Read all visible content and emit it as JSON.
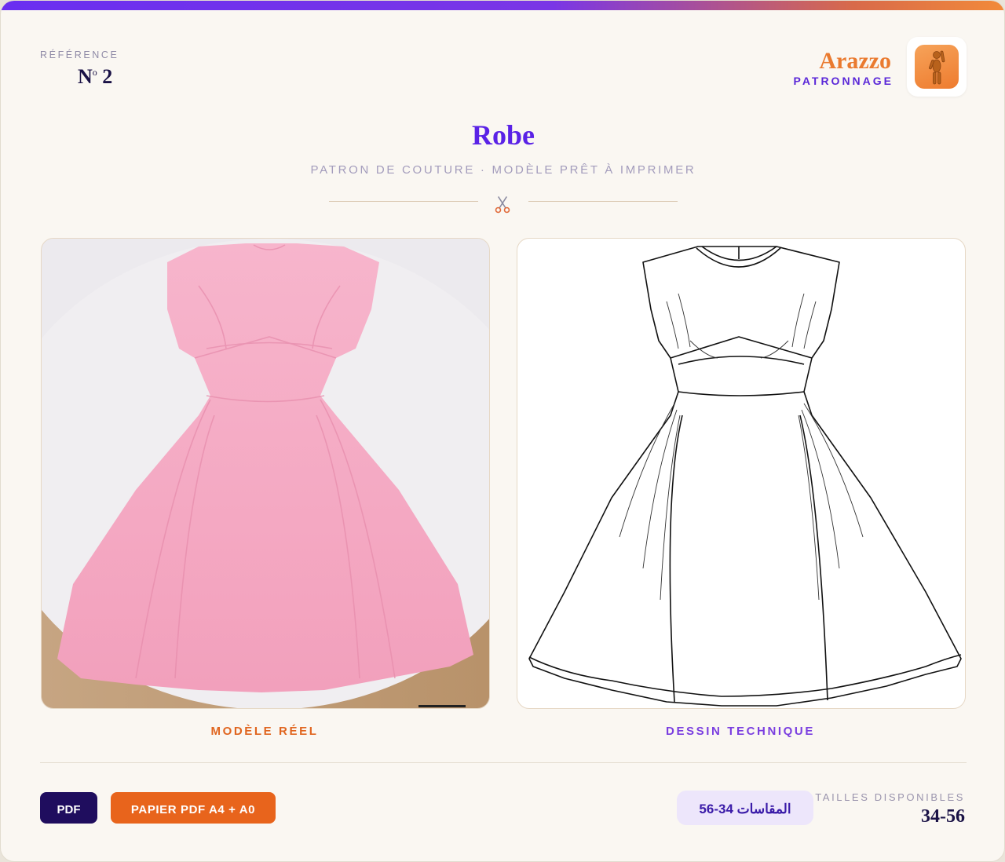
{
  "header": {
    "reference_label": "RÉFÉRENCE",
    "reference_prefix": "N",
    "reference_sup": "o",
    "reference_number": "2",
    "brand_name": "Arazzo",
    "brand_sub": "PATRONNAGE",
    "logo_icon": "wooden-mannequin-icon"
  },
  "main": {
    "title": "Robe",
    "subtitle": "PATRON DE COUTURE · MODÈLE PRÊT À IMPRIMER",
    "divider_icon": "scissors-icon"
  },
  "panels": {
    "photo_caption": "MODÈLE RÉEL",
    "tech_caption": "DESSIN TECHNIQUE"
  },
  "footer": {
    "pdf_label": "PDF",
    "paper_label": "PAPIER PDF A4 + A0",
    "arabic_sizes": "المقاسات 34-56",
    "sizes_label": "TAILLES DISPONIBLES",
    "sizes_value": "34-56"
  },
  "colors": {
    "accent_purple": "#5a22e6",
    "accent_orange": "#e8641c",
    "navy": "#1f0d5e",
    "dress_pink": "#f4aac4"
  }
}
